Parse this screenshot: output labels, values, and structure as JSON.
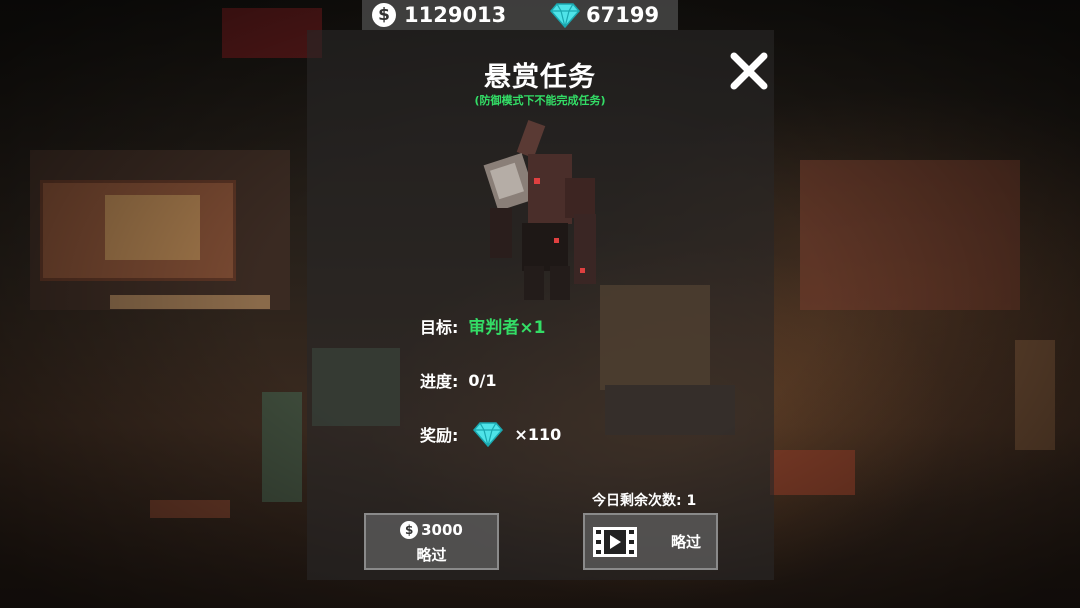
{
  "currency": {
    "coins": "1129013",
    "gems": "67199"
  },
  "panel": {
    "title": "悬赏任务",
    "subtitle": "(防御模式下不能完成任务)",
    "target_label": "目标:",
    "target_value": "审判者×1",
    "progress_label": "进度:",
    "progress_value": "0/1",
    "reward_label": "奖励:",
    "reward_value": "×110",
    "remaining": "今日剩余次数: 1",
    "skip_coins_cost": "3000",
    "skip_coins_label": "略过",
    "skip_video_label": "略过"
  },
  "icons": {
    "coin": "dollar-coin-icon",
    "gem": "diamond-gem-icon",
    "close": "close-x-icon",
    "video": "film-strip-icon"
  },
  "colors": {
    "accent_green": "#33dd66",
    "gem": "#4fe3e8",
    "panel_bg": "rgba(40,38,38,0.62)"
  }
}
